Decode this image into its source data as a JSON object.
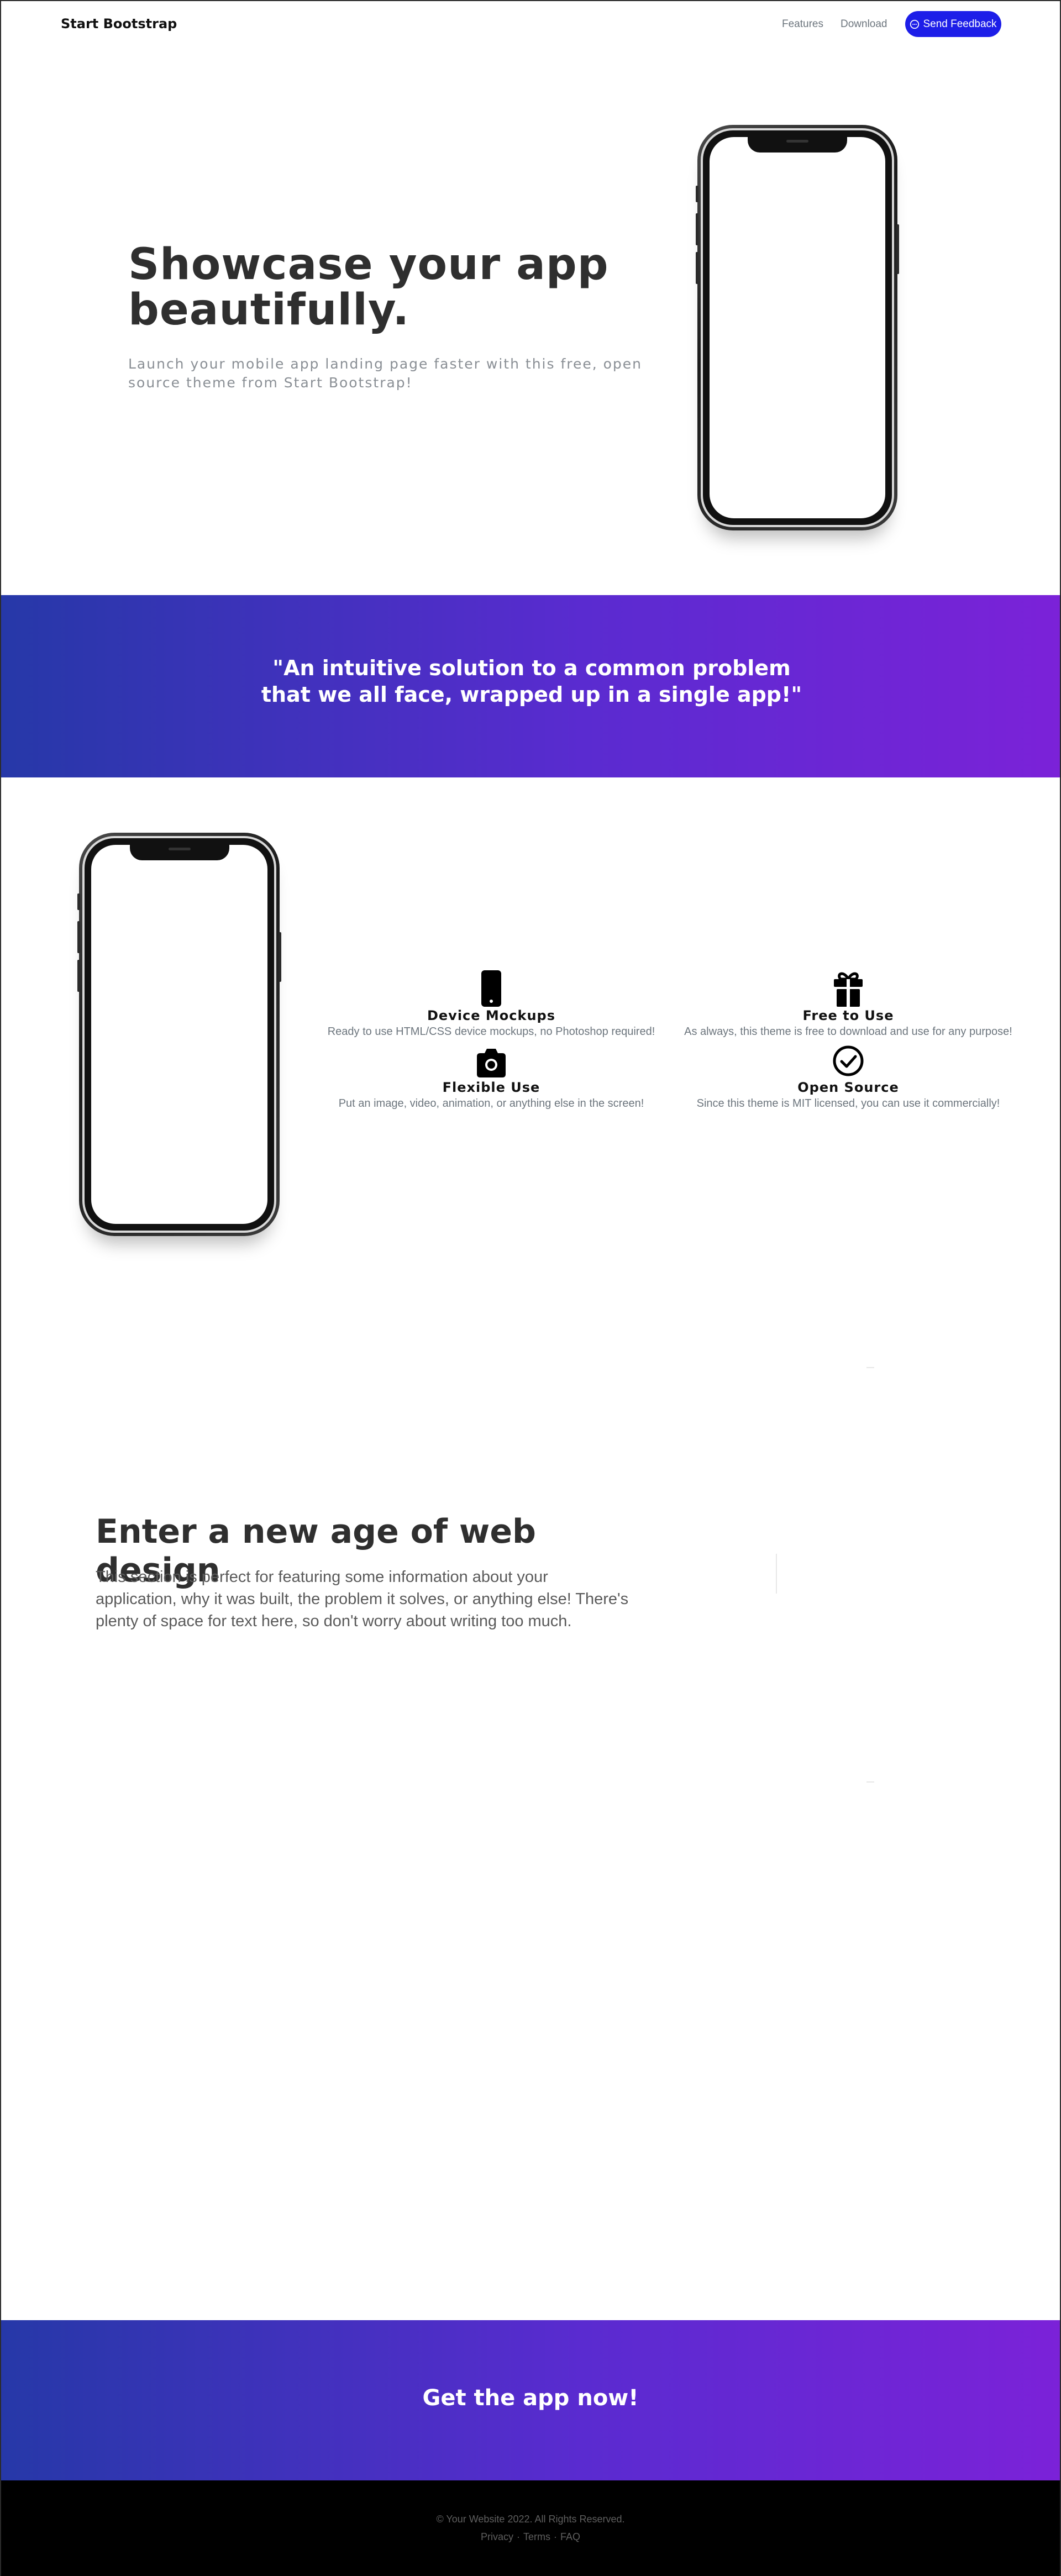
{
  "navbar": {
    "brand": "Start Bootstrap",
    "links": [
      "Features",
      "Download"
    ],
    "feedback_label": "Send Feedback"
  },
  "hero": {
    "title": "Showcase your app beautifully.",
    "subtitle": "Launch your mobile app landing page faster with this free, open source theme from Start Bootstrap!"
  },
  "quote": {
    "text": "\"An intuitive solution to a common problem that we all face, wrapped up in a single app!\""
  },
  "features": [
    {
      "icon": "phone-icon",
      "title": "Device Mockups",
      "description": "Ready to use HTML/CSS device mockups, no Photoshop required!"
    },
    {
      "icon": "gift-icon",
      "title": "Free to Use",
      "description": "As always, this theme is free to download and use for any purpose!"
    },
    {
      "icon": "camera-icon",
      "title": "Flexible Use",
      "description": "Put an image, video, animation, or anything else in the screen!"
    },
    {
      "icon": "check-circle-icon",
      "title": "Open Source",
      "description": "Since this theme is MIT licensed, you can use it commercially!"
    }
  ],
  "about": {
    "title": "Enter a new age of web design",
    "text": "This section is perfect for featuring some information about your application, why it was built, the problem it solves, or anything else! There's plenty of space for text here, so don't worry about writing too much."
  },
  "cta": {
    "text": "Get the app now!"
  },
  "footer": {
    "copyright": "© Your Website 2022. All Rights Reserved.",
    "links": [
      "Privacy",
      "Terms",
      "FAQ"
    ]
  },
  "colors": {
    "accent": "#1d1ee8",
    "gradient_start": "#2638a8",
    "gradient_end": "#7b22d8",
    "footer_bg": "#000000"
  }
}
